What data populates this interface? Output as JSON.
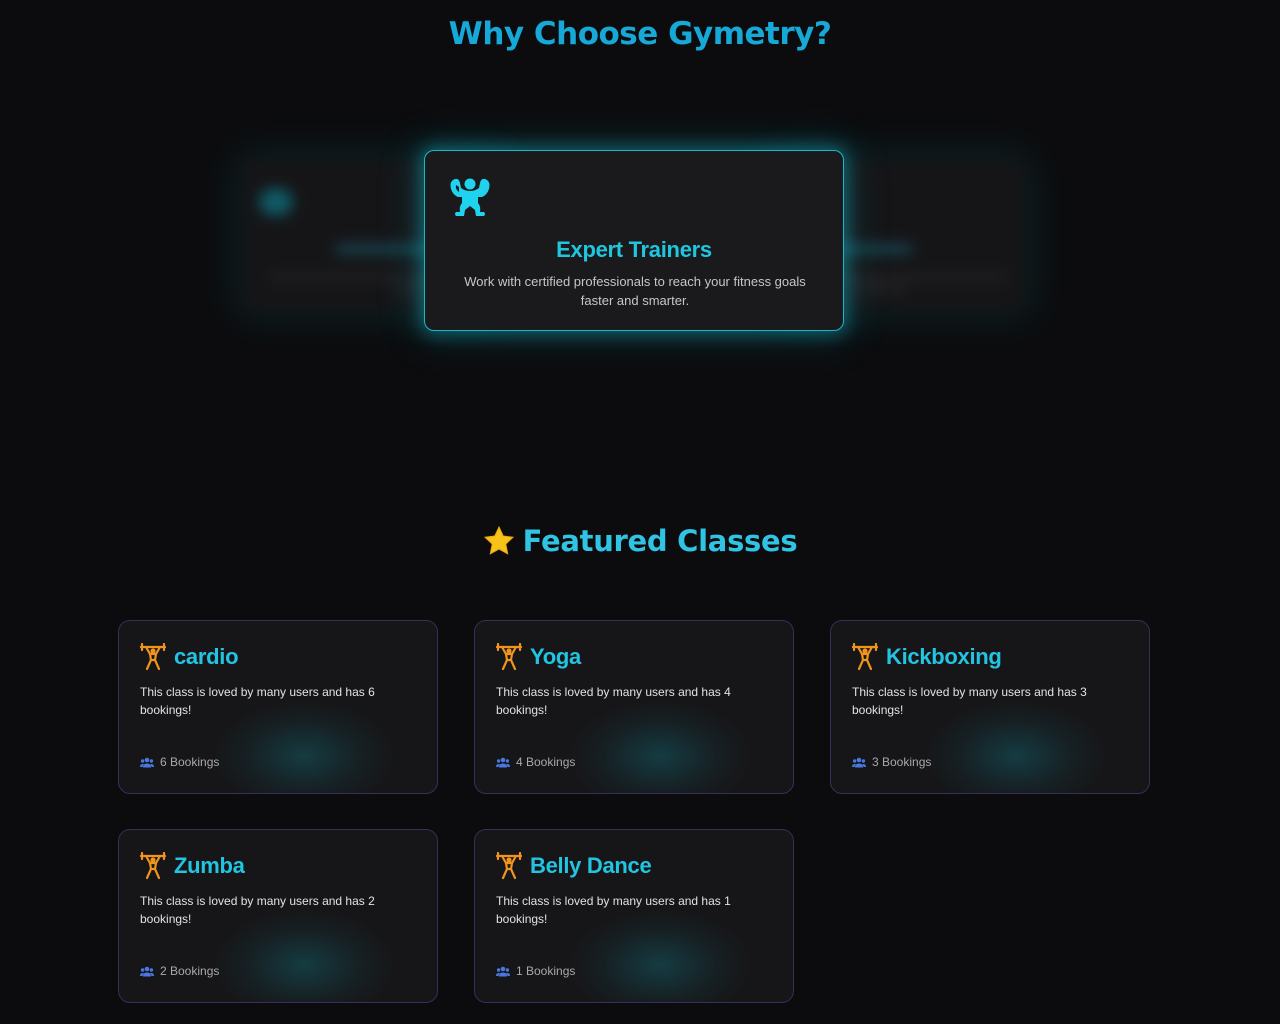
{
  "why": {
    "title": "Why Choose Gymetry?",
    "active_card": {
      "icon": "bodybuilder-icon",
      "title": "Expert Trainers",
      "description": "Work with certified professionals to reach your fitness goals faster and smarter."
    }
  },
  "featured": {
    "icon": "star-icon",
    "title": "Featured Classes",
    "classes": [
      {
        "name": "cardio",
        "description": "This class is loved by many users and has 6 bookings!",
        "bookings": "6 Bookings"
      },
      {
        "name": "Yoga",
        "description": "This class is loved by many users and has 4 bookings!",
        "bookings": "4 Bookings"
      },
      {
        "name": "Kickboxing",
        "description": "This class is loved by many users and has 3 bookings!",
        "bookings": "3 Bookings"
      },
      {
        "name": "Zumba",
        "description": "This class is loved by many users and has 2 bookings!",
        "bookings": "2 Bookings"
      },
      {
        "name": "Belly Dance",
        "description": "This class is loved by many users and has 1 bookings!",
        "bookings": "1 Bookings"
      }
    ]
  },
  "colors": {
    "accent": "#1fc6e0",
    "background": "#0c0c0e",
    "card_border": "#34305a",
    "icon_orange": "#f0941e",
    "booking_icon": "#4a78e0"
  }
}
